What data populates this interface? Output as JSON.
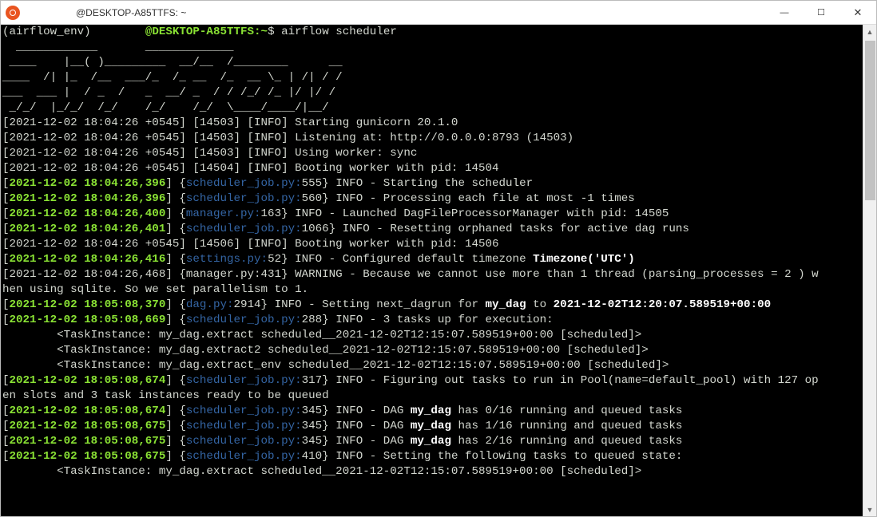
{
  "window": {
    "title": "@DESKTOP-A85TTFS: ~",
    "minimize": "—",
    "maximize": "☐",
    "close": "✕"
  },
  "prompt": {
    "env": "(airflow_env) ",
    "user": "       ",
    "host": "@DESKTOP-A85TTFS",
    "path": ":~",
    "sep": "$ ",
    "cmd": "airflow scheduler"
  },
  "ascii": [
    "  ____________       _____________",
    " ____    |__( )_________  __/__  /________      __",
    "____  /| |_  /__  ___/_  /_ __  /_  __ \\_ | /| / /",
    "___  ___ |  / _  /   _  __/ _  / / /_/ /_ |/ |/ /",
    " _/_/  |_/_/  /_/    /_/    /_/  \\____/____/|__/"
  ],
  "lines": [
    {
      "t": "plain",
      "txt": "[2021-12-02 18:04:26 +0545] [14503] [INFO] Starting gunicorn 20.1.0"
    },
    {
      "t": "plain",
      "txt": "[2021-12-02 18:04:26 +0545] [14503] [INFO] Listening at: http://0.0.0.0:8793 (14503)"
    },
    {
      "t": "plain",
      "txt": "[2021-12-02 18:04:26 +0545] [14503] [INFO] Using worker: sync"
    },
    {
      "t": "plain",
      "txt": "[2021-12-02 18:04:26 +0545] [14504] [INFO] Booting worker with pid: 14504"
    },
    {
      "t": "color",
      "ts": "2021-12-02 18:04:26,396",
      "src": "scheduler_job.py:",
      "ln": "555",
      "msg": "} INFO - Starting the scheduler"
    },
    {
      "t": "color",
      "ts": "2021-12-02 18:04:26,396",
      "src": "scheduler_job.py:",
      "ln": "560",
      "msg": "} INFO - Processing each file at most -1 times"
    },
    {
      "t": "color",
      "ts": "2021-12-02 18:04:26,400",
      "src": "manager.py:",
      "ln": "163",
      "msg": "} INFO - Launched DagFileProcessorManager with pid: 14505"
    },
    {
      "t": "color",
      "ts": "2021-12-02 18:04:26,401",
      "src": "scheduler_job.py:",
      "ln": "1066",
      "msg": "} INFO - Resetting orphaned tasks for active dag runs"
    },
    {
      "t": "plain",
      "txt": "[2021-12-02 18:04:26 +0545] [14506] [INFO] Booting worker with pid: 14506"
    },
    {
      "t": "tz",
      "ts": "2021-12-02 18:04:26,416",
      "src": "settings.py:",
      "ln": "52",
      "pre": "} INFO - Configured default timezone ",
      "bold": "Timezone('UTC')"
    },
    {
      "t": "plain",
      "txt": "[2021-12-02 18:04:26,468] {manager.py:431} WARNING - Because we cannot use more than 1 thread (parsing_processes = 2 ) w"
    },
    {
      "t": "plain",
      "txt": "hen using sqlite. So we set parallelism to 1."
    },
    {
      "t": "dag",
      "ts": "2021-12-02 18:05:08,370",
      "src": "dag.py:",
      "ln": "2914",
      "pre": "} INFO - Setting next_dagrun for ",
      "b1": "my_dag",
      "mid": " to ",
      "b2": "2021-12-02T12:20:07.589519+00:00"
    },
    {
      "t": "color",
      "ts": "2021-12-02 18:05:08,669",
      "src": "scheduler_job.py:",
      "ln": "288",
      "msg": "} INFO - 3 tasks up for execution:"
    },
    {
      "t": "plain",
      "txt": "        <TaskInstance: my_dag.extract scheduled__2021-12-02T12:15:07.589519+00:00 [scheduled]>"
    },
    {
      "t": "plain",
      "txt": "        <TaskInstance: my_dag.extract2 scheduled__2021-12-02T12:15:07.589519+00:00 [scheduled]>"
    },
    {
      "t": "plain",
      "txt": "        <TaskInstance: my_dag.extract_env scheduled__2021-12-02T12:15:07.589519+00:00 [scheduled]>"
    },
    {
      "t": "color",
      "ts": "2021-12-02 18:05:08,674",
      "src": "scheduler_job.py:",
      "ln": "317",
      "msg": "} INFO - Figuring out tasks to run in Pool(name=default_pool) with 127 op"
    },
    {
      "t": "plain",
      "txt": "en slots and 3 task instances ready to be queued"
    },
    {
      "t": "dagn",
      "ts": "2021-12-02 18:05:08,674",
      "src": "scheduler_job.py:",
      "ln": "345",
      "pre": "} INFO - DAG ",
      "b1": "my_dag",
      "post": " has 0/16 running and queued tasks"
    },
    {
      "t": "dagn",
      "ts": "2021-12-02 18:05:08,675",
      "src": "scheduler_job.py:",
      "ln": "345",
      "pre": "} INFO - DAG ",
      "b1": "my_dag",
      "post": " has 1/16 running and queued tasks"
    },
    {
      "t": "dagn",
      "ts": "2021-12-02 18:05:08,675",
      "src": "scheduler_job.py:",
      "ln": "345",
      "pre": "} INFO - DAG ",
      "b1": "my_dag",
      "post": " has 2/16 running and queued tasks"
    },
    {
      "t": "color",
      "ts": "2021-12-02 18:05:08,675",
      "src": "scheduler_job.py:",
      "ln": "410",
      "msg": "} INFO - Setting the following tasks to queued state:"
    },
    {
      "t": "plain",
      "txt": "        <TaskInstance: my_dag.extract scheduled__2021-12-02T12:15:07.589519+00:00 [scheduled]>"
    }
  ]
}
